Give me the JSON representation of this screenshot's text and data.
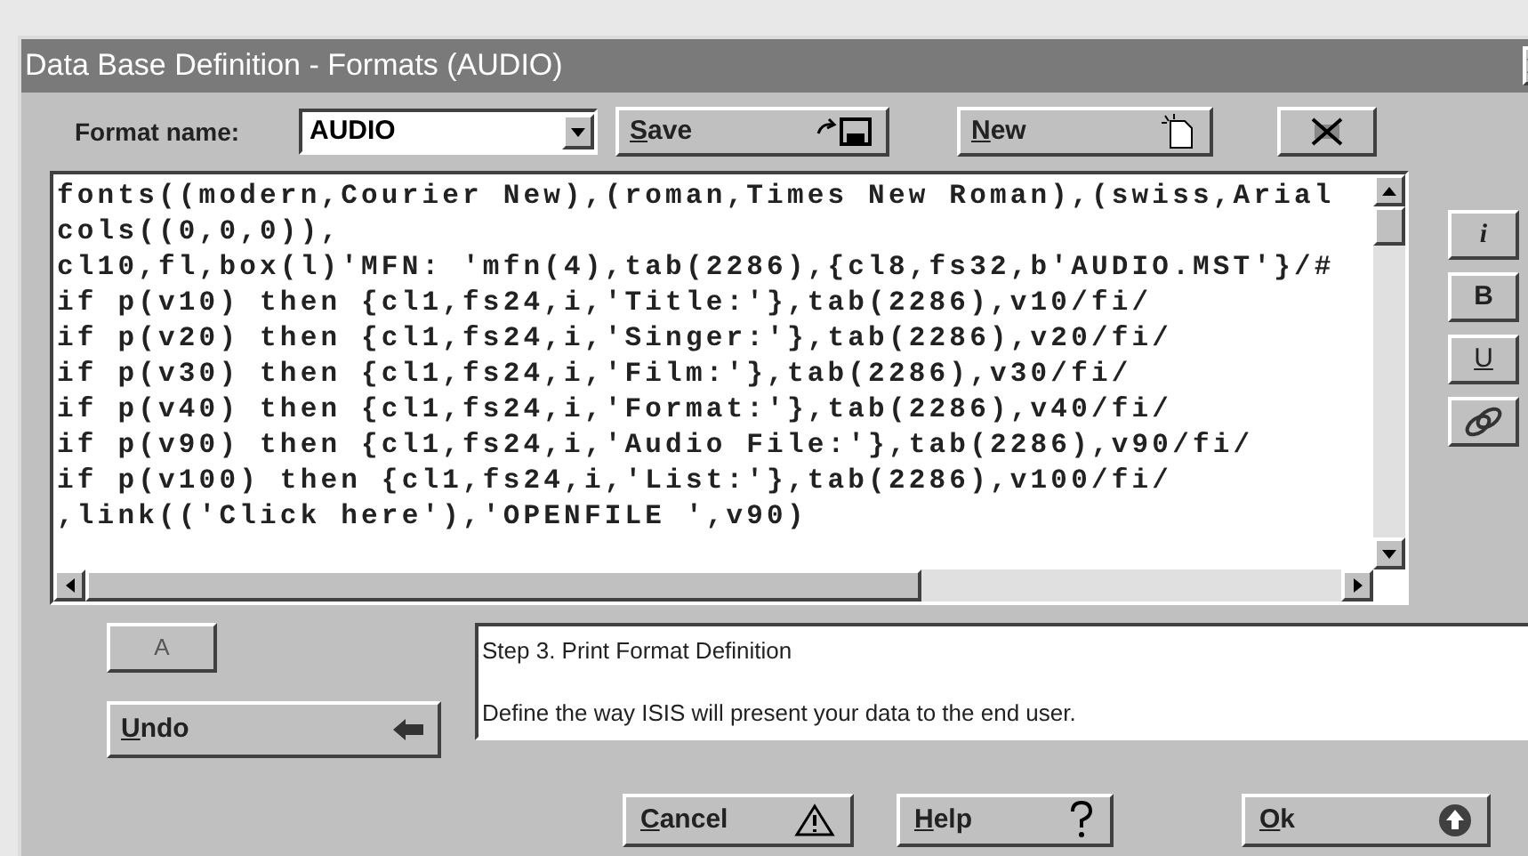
{
  "window": {
    "title": "Data Base Definition - Formats (AUDIO)"
  },
  "toolbar": {
    "format_label": "Format name:",
    "format_value": "AUDIO",
    "buttons": [
      {
        "label": "Save",
        "kind": "save"
      },
      {
        "label": "New",
        "kind": "new"
      },
      {
        "kind": "delete"
      }
    ]
  },
  "editor": {
    "lines": [
      "fonts((modern,Courier New),(roman,Times New Roman),(swiss,Arial",
      "cols((0,0,0)),",
      "cl10,fl,box(l)'MFN: 'mfn(4),tab(2286),{cl8,fs32,b'AUDIO.MST'}/#",
      "if p(v10) then {cl1,fs24,i,'Title:'},tab(2286),v10/fi/",
      "if p(v20) then {cl1,fs24,i,'Singer:'},tab(2286),v20/fi/",
      "if p(v30) then {cl1,fs24,i,'Film:'},tab(2286),v30/fi/",
      "if p(v40) then {cl1,fs24,i,'Format:'},tab(2286),v40/fi/",
      "if p(v90) then {cl1,fs24,i,'Audio File:'},tab(2286),v90/fi/",
      "if p(v100) then {cl1,fs24,i,'List:'},tab(2286),v100/fi/",
      ",link(('Click here'),'OPENFILE ',v90)"
    ]
  },
  "style_buttons": [
    {
      "kind": "italic",
      "label": "i"
    },
    {
      "kind": "bold",
      "label": "B"
    },
    {
      "kind": "underline",
      "label": "U"
    },
    {
      "kind": "link"
    }
  ],
  "font_button": {
    "label": "A"
  },
  "undo": {
    "label": "Undo"
  },
  "help_box": {
    "step": "Step 3. Print Format Definition",
    "text": "Define the way ISIS will present your data to the end user."
  },
  "footer_buttons": [
    {
      "label": "Cancel",
      "kind": "warning"
    },
    {
      "label": "Help",
      "kind": "help"
    },
    {
      "label": "Ok",
      "kind": "ok"
    }
  ]
}
